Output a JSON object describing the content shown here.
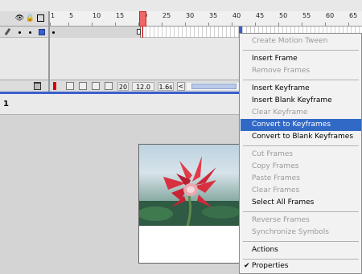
{
  "timeline": {
    "ruler_labels": [
      "1",
      "5",
      "10",
      "15",
      "20",
      "25",
      "30",
      "35",
      "40",
      "45",
      "50",
      "55",
      "60",
      "65"
    ],
    "current_frame": "20",
    "fps": "12.0 fps",
    "elapsed": "1.6s",
    "scroll_left": "<"
  },
  "scene": {
    "number": "1"
  },
  "context_menu": {
    "create_motion_tween": "Create Motion Tween",
    "insert_frame": "Insert Frame",
    "remove_frames": "Remove Frames",
    "insert_keyframe": "Insert Keyframe",
    "insert_blank_keyframe": "Insert Blank Keyframe",
    "clear_keyframe": "Clear Keyframe",
    "convert_to_keyframes": "Convert to Keyframes",
    "convert_to_blank_keyframes": "Convert to Blank Keyframes",
    "cut_frames": "Cut Frames",
    "copy_frames": "Copy Frames",
    "paste_frames": "Paste Frames",
    "clear_frames": "Clear Frames",
    "select_all_frames": "Select All Frames",
    "reverse_frames": "Reverse Frames",
    "synchronize_symbols": "Synchronize Symbols",
    "actions": "Actions",
    "properties": "Properties",
    "properties_checked": true
  },
  "colors": {
    "highlight": "#3169c6",
    "playhead": "#dd2222",
    "selection": "#3a5fcd",
    "disabled_text": "#9a9a9a"
  }
}
